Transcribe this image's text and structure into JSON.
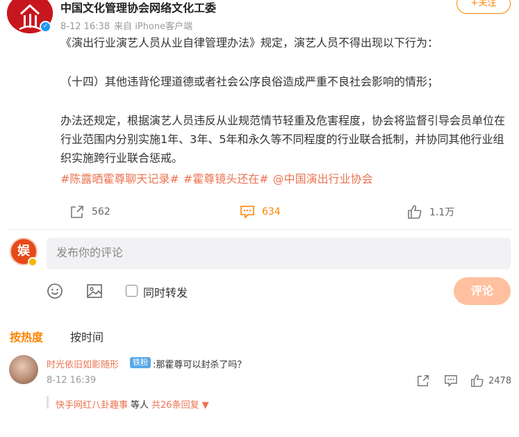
{
  "post": {
    "author": "中国文化管理协会网络文化工委",
    "time": "8-12 16:38",
    "source": "来自 iPhone客户端",
    "follow_label": "+关注",
    "paragraphs": [
      "《演出行业演艺人员从业自律管理办法》规定，演艺人员不得出现以下行为：",
      "（十四）其他违背伦理道德或者社会公序良俗造成严重不良社会影响的情形；",
      "办法还规定，根据演艺人员违反从业规范情节轻重及危害程度，协会将监督引导会员单位在行业范围内分别实施1年、3年、5年和永久等不同程度的行业联合抵制，并协同其他行业组织实施跨行业联合惩戒。"
    ],
    "tags": [
      "#陈露晒霍尊聊天记录#",
      "#霍尊镜头还在#",
      "@中国演出行业协会"
    ],
    "actions": {
      "share_count": "562",
      "comment_count": "634",
      "like_count": "1.1万"
    }
  },
  "compose": {
    "placeholder": "发布你的评论",
    "repost_label": "同时转发",
    "submit_label": "评论",
    "avatar_char": "娱"
  },
  "sort": {
    "hot": "按热度",
    "time": "按时间"
  },
  "comments": [
    {
      "user": "时光依旧如影随形",
      "badge": "铁粉",
      "text": ":那霍尊可以封杀了吗？",
      "time": "8-12 16:39",
      "like_count": "2478",
      "reply_from": "快手网红八卦趣事",
      "reply_mid": "等人",
      "reply_total": "共26条回复"
    }
  ],
  "colors": {
    "accent": "#ff8200",
    "link": "#eb7350",
    "brand_red": "#c8161e",
    "verify_blue": "#2196f3"
  }
}
